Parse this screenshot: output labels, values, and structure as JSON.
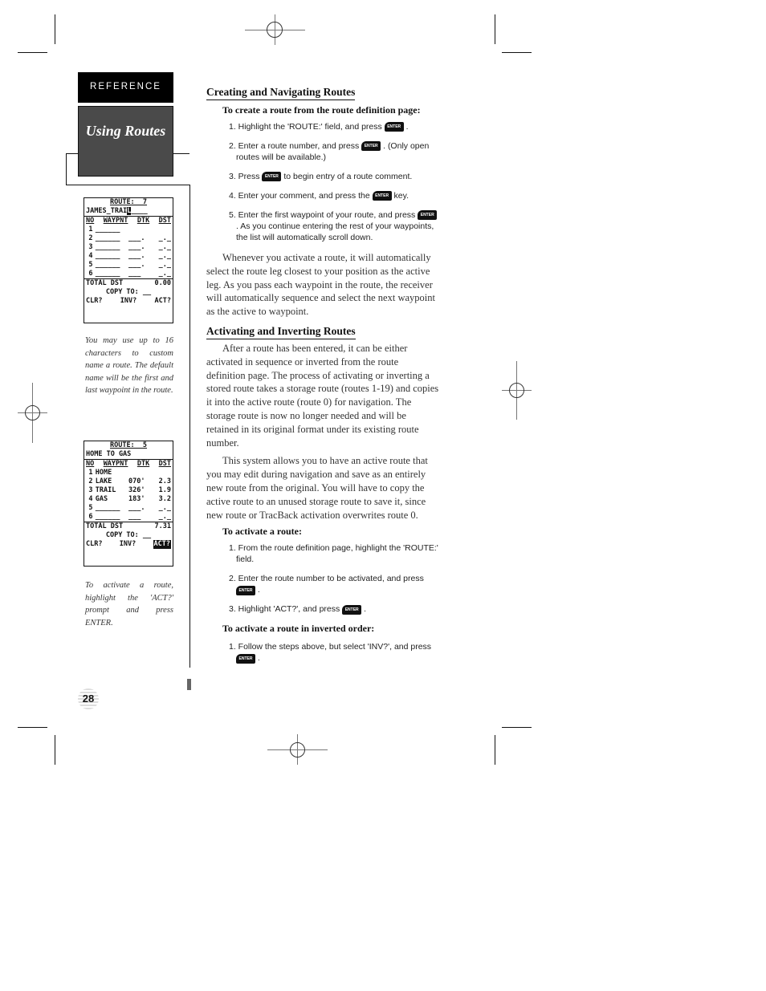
{
  "sidebar": {
    "reference_tab": "REFERENCE",
    "chapter_title": "Using Routes",
    "screen1": {
      "route_line": "ROUTE:  7",
      "name_line": "JAMES_TRAI",
      "name_cursor": "L",
      "name_tail": "____",
      "headers": {
        "no": "NO",
        "waypoint": "WAYPNT",
        "dtk": "DTK",
        "dst": "DST"
      },
      "rows": [
        {
          "no": "1",
          "name": "______",
          "dtk": "",
          "dst": ""
        },
        {
          "no": "2",
          "name": "______",
          "dtk": "___.",
          "dst": "_._"
        },
        {
          "no": "3",
          "name": "______",
          "dtk": "___.",
          "dst": "_._"
        },
        {
          "no": "4",
          "name": "______",
          "dtk": "___.",
          "dst": "_._"
        },
        {
          "no": "5",
          "name": "______",
          "dtk": "___.",
          "dst": "_._"
        },
        {
          "no": "6",
          "name": "______",
          "dtk": "___",
          "dst": "_._"
        }
      ],
      "total_label": "TOTAL DST",
      "total_value": "0.00",
      "copy_line": "COPY TO: __",
      "prompts": [
        "CLR?",
        "INV?",
        "ACT?"
      ],
      "highlighted_prompt": ""
    },
    "caption1": "You may use up to 16 characters to custom name a route. The default name will be the first and last waypoint in the route.",
    "screen2": {
      "route_line": "ROUTE:  5",
      "name_line": "HOME TO GAS",
      "headers": {
        "no": "NO",
        "waypoint": "WAYPNT",
        "dtk": "DTK",
        "dst": "DST"
      },
      "rows": [
        {
          "no": "1",
          "name": "HOME",
          "dtk": "",
          "dst": ""
        },
        {
          "no": "2",
          "name": "LAKE",
          "dtk": "070'",
          "dst": "2.3"
        },
        {
          "no": "3",
          "name": "TRAIL",
          "dtk": "326'",
          "dst": "1.9"
        },
        {
          "no": "4",
          "name": "GAS",
          "dtk": "183'",
          "dst": "3.2"
        },
        {
          "no": "5",
          "name": "______",
          "dtk": "___.",
          "dst": "_._"
        },
        {
          "no": "6",
          "name": "______",
          "dtk": "___",
          "dst": "_._"
        }
      ],
      "total_label": "TOTAL DST",
      "total_value": "7.31",
      "copy_line": "COPY TO: __",
      "prompts": [
        "CLR?",
        "INV?",
        "ACT?"
      ],
      "highlighted_prompt": "ACT?"
    },
    "caption2": "To activate a route, highlight the 'ACT?' prompt and press ENTER.",
    "page_number": "28"
  },
  "main": {
    "section1": {
      "heading": "Creating and Navigating Routes",
      "subheading": "To create a route from the route definition page:",
      "steps": [
        {
          "before": "1. Highlight the 'ROUTE:' field, and press",
          "after": "."
        },
        {
          "before": "2. Enter a route number, and press",
          "after": ". (Only open routes will be available.)"
        },
        {
          "before": "3. Press",
          "after": "to begin entry of a route comment."
        },
        {
          "before": "4. Enter your comment, and press the",
          "after": "key."
        },
        {
          "before": "5. Enter the first waypoint of your route, and press",
          "after": ". As you continue entering the rest of your waypoints, the list will automatically scroll down."
        }
      ],
      "paragraph": "Whenever you activate a route, it will automatically select the route leg closest to your position as the active leg. As you pass each waypoint in the route, the receiver will automatically sequence and select the next waypoint as the active to waypoint."
    },
    "section2": {
      "heading": "Activating and Inverting Routes",
      "paragraph1": "After a route has been entered, it can be either activated in sequence or inverted from the route definition page. The process of activating or inverting a stored route takes a storage route (routes 1-19) and copies it into the active route (route 0) for navigation. The storage route is now no longer needed and will be retained in its original format under its existing route number.",
      "paragraph2": "This system allows you to have an active route that you may edit during navigation and save as an entirely new route from the original. You will have to copy the active route to an unused storage route to save it, since new route or TracBack activation overwrites route 0.",
      "activate_heading": "To activate a route:",
      "activate_steps": [
        {
          "before": "1. From the route definition page, highlight the 'ROUTE:' field.",
          "after": ""
        },
        {
          "before": "2. Enter the route number to be activated, and press",
          "after": "."
        },
        {
          "before": "3. Highlight 'ACT?', and press",
          "after": "."
        }
      ],
      "invert_heading": "To activate a route in inverted order:",
      "invert_steps": [
        {
          "before": "1. Follow the steps above, but select 'INV?', and press",
          "after": "."
        }
      ]
    },
    "enter_key_label": "ENTER"
  }
}
